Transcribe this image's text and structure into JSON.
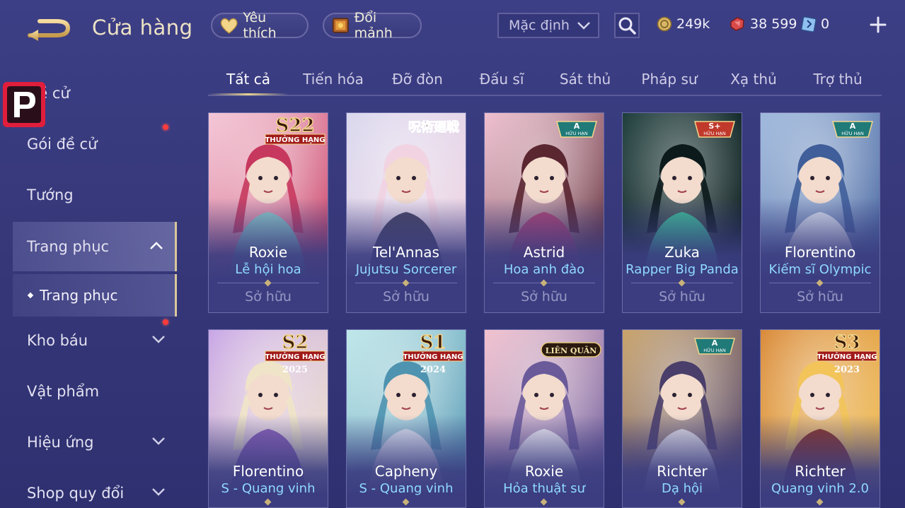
{
  "header": {
    "title": "Cửa hàng",
    "favorite_label": "Yêu thích",
    "exchange_label": "Đổi mảnh",
    "sort_value": "Mặc định",
    "currencies": [
      {
        "icon": "gold-coin-icon",
        "value": "249k"
      },
      {
        "icon": "voucher-gem-icon",
        "value": "38 599"
      },
      {
        "icon": "ticket-icon",
        "value": "0"
      }
    ]
  },
  "sidebar": {
    "items": [
      {
        "label": "Đề cử"
      },
      {
        "label": "Gói đề cử"
      },
      {
        "label": "Tướng"
      },
      {
        "label": "Trang phục"
      },
      {
        "label": "Trang phục"
      },
      {
        "label": "Kho báu"
      },
      {
        "label": "Vật phẩm"
      },
      {
        "label": "Hiệu ứng"
      },
      {
        "label": "Shop quy đổi"
      }
    ]
  },
  "tabs": [
    "Tất cả",
    "Tiến hóa",
    "Đỡ đòn",
    "Đấu sĩ",
    "Sát thủ",
    "Pháp sư",
    "Xạ thủ",
    "Trợ thủ"
  ],
  "cards": [
    {
      "hero": "Roxie",
      "skin": "Lễ hội hoa",
      "status": "Sở hữu",
      "badge_top": "S22",
      "badge_bottom": "THƯỞNG HẠNG",
      "palette": [
        "#f4c7d8",
        "#7fd6d0",
        "#c7385e"
      ]
    },
    {
      "hero": "Tel'Annas",
      "skin": "Jujutsu Sorcerer",
      "status": "Sở hữu",
      "badge_top": "呪術廻戦",
      "badge_bottom": "",
      "palette": [
        "#d9d7ee",
        "#2a2a4a",
        "#f1d3e2"
      ]
    },
    {
      "hero": "Astrid",
      "skin": "Hoa anh đào",
      "status": "Sở hữu",
      "badge_top": "A",
      "badge_bottom": "HỮU HẠN",
      "palette": [
        "#f0bfd0",
        "#b23a6e",
        "#5a2630"
      ]
    },
    {
      "hero": "Zuka",
      "skin": "Rapper Big Panda",
      "status": "Sở hữu",
      "badge_top": "S+",
      "badge_bottom": "HỮU HẠN",
      "palette": [
        "#1e3e3c",
        "#3bd0a0",
        "#0c1a1c"
      ]
    },
    {
      "hero": "Florentino",
      "skin": "Kiếm sĩ Olympic",
      "status": "Sở hữu",
      "badge_top": "A",
      "badge_bottom": "HỮU HẠN",
      "palette": [
        "#9fb9dd",
        "#e9eef6",
        "#3f5e9a"
      ]
    },
    {
      "hero": "Florentino",
      "skin": "S - Quang vinh",
      "status": "",
      "badge_top": "S2",
      "badge_bottom": "THƯỞNG HẠNG",
      "badge_year": "2025",
      "palette": [
        "#c8a6e6",
        "#7a4db0",
        "#f0e4c8"
      ]
    },
    {
      "hero": "Capheny",
      "skin": "S - Quang vinh",
      "status": "",
      "badge_top": "S1",
      "badge_bottom": "THƯỞNG HẠNG",
      "badge_year": "2024",
      "palette": [
        "#bfe8ea",
        "#f0f0f8",
        "#4e93b0"
      ]
    },
    {
      "hero": "Roxie",
      "skin": "Hỏa thuật sư",
      "status": "",
      "badge_top": "LIÊN QUÂN",
      "badge_bottom": "",
      "palette": [
        "#f3c2cf",
        "#ffffff",
        "#6a5a9a"
      ]
    },
    {
      "hero": "Richter",
      "skin": "Dạ hội",
      "status": "",
      "badge_top": "A",
      "badge_bottom": "HỮU HẠN",
      "palette": [
        "#c9a36a",
        "#f1f1f6",
        "#4a3e6a"
      ]
    },
    {
      "hero": "Richter",
      "skin": "Quang vinh 2.0",
      "status": "",
      "badge_top": "S3",
      "badge_bottom": "THƯỞNG HẠNG",
      "badge_year": "2023",
      "palette": [
        "#d98a3a",
        "#7a1e1a",
        "#f2c45a"
      ]
    }
  ]
}
